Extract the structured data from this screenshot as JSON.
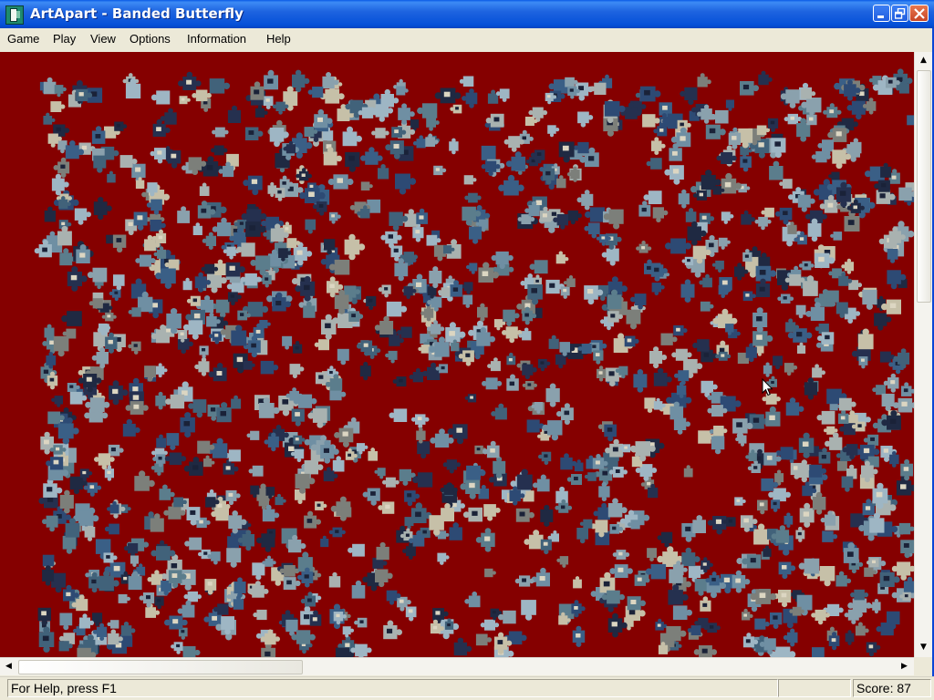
{
  "window": {
    "title": "ArtApart - Banded Butterfly",
    "controls": {
      "minimize": "minimize",
      "maximize": "maximize",
      "close": "close"
    }
  },
  "menu": {
    "items": [
      {
        "label": "Game"
      },
      {
        "label": "Play"
      },
      {
        "label": "View"
      },
      {
        "label": "Options"
      },
      {
        "label": "Information"
      },
      {
        "label": "Help"
      }
    ]
  },
  "playfield": {
    "background_color": "#850000",
    "piece_palette": [
      "#6f8fa3",
      "#3a5f86",
      "#8aa1ad",
      "#25304f",
      "#a9b2b0",
      "#5b7d8c",
      "#2d4a74",
      "#c6c0a8",
      "#41627a",
      "#7c7f7a",
      "#1f2942",
      "#9eb6c4"
    ]
  },
  "status": {
    "help_text": "For Help, press F1",
    "score_text": "Score: 87"
  },
  "colors": {
    "title_bar": "#0a5ae6",
    "chrome": "#ece9d8"
  }
}
